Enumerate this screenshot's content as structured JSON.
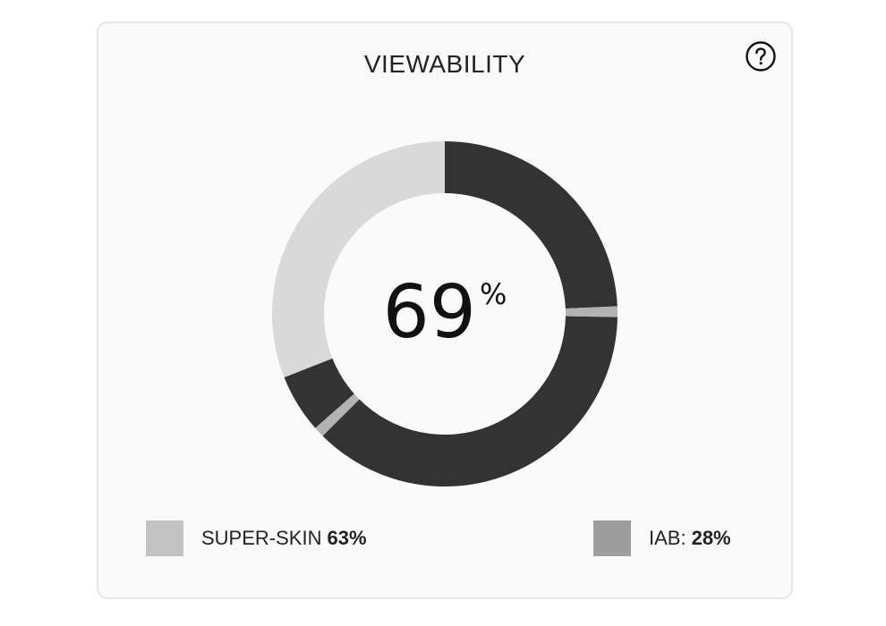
{
  "card": {
    "title": "VIEWABILITY",
    "help_icon": "question-circle-icon"
  },
  "chart_data": {
    "type": "pie",
    "style": "donut",
    "center_value": "69",
    "center_unit": "%",
    "legend_placement": "bottom",
    "segments_clockwise_from_top": [
      {
        "share": 0.243,
        "color": "#333333"
      },
      {
        "share": 0.01,
        "color": "#b3b3b3"
      },
      {
        "share": 0.372,
        "color": "#333333"
      },
      {
        "share": 0.01,
        "color": "#b3b3b3"
      },
      {
        "share": 0.055,
        "color": "#333333"
      },
      {
        "share": 0.31,
        "color": "#d9d9d9"
      }
    ],
    "legend": [
      {
        "label": "SUPER-SKIN",
        "value": "63%",
        "color": "#c2c2c2"
      },
      {
        "label": "IAB:",
        "value": "28%",
        "color": "#9e9e9e"
      }
    ]
  }
}
